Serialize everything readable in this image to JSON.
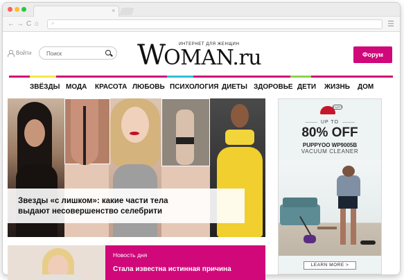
{
  "browser": {
    "tab_close": "×",
    "url_search_glyph": "⌕",
    "nav_back": "←",
    "nav_forward": "→",
    "nav_reload": "C",
    "nav_home": "⌂",
    "menu_glyph": "☰"
  },
  "header": {
    "login_label": "Войти",
    "search_placeholder": "Поиск",
    "tagline": "ИНТЕРНЕТ ДЛЯ ЖЕНЩИН",
    "logo_big": "W",
    "logo_rest": "OMAN.ru",
    "forum_label": "Форум"
  },
  "nav": {
    "items": [
      "ЗВЁЗДЫ",
      "МОДА",
      "КРАСОТА",
      "ЛЮБОВЬ",
      "ПСИХОЛОГИЯ",
      "ДИЕТЫ",
      "ЗДОРОВЬЕ",
      "ДЕТИ",
      "ЖИЗНЬ",
      "ДОМ"
    ]
  },
  "hero": {
    "title_line1": "Звезды «с лишком»: какие части тела",
    "title_line2": "выдают несовершенство селебрити"
  },
  "ad": {
    "badge": "PUPPY",
    "up_to": "UP TO",
    "percent": "80% OFF",
    "model": "PUPPYOO WP9005B",
    "type": "VACUUM CLEANER",
    "cta": "LEARN MORE >"
  },
  "card2": {
    "label": "Новость дня",
    "title": "Стала известна истинная причина"
  },
  "colors": {
    "accent": "#d0087a",
    "rule": [
      "#d0087a",
      "#f2e64e",
      "#2fbfd6",
      "#8bd24a"
    ]
  }
}
